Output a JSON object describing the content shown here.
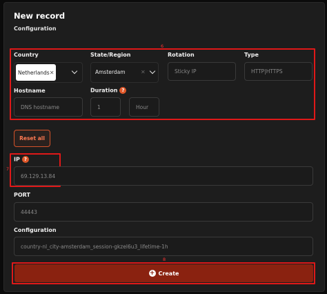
{
  "header": {
    "title": "New record",
    "subtitle": "Configuration"
  },
  "markers": {
    "config_box": "6",
    "ip_box": "7",
    "create_box": "8"
  },
  "country": {
    "label": "Country",
    "selected_chip": "Netherlands",
    "chip_remove": "✕"
  },
  "state": {
    "label": "State/Region",
    "value": "Amsterdam",
    "clear": "✕"
  },
  "rotation": {
    "label": "Rotation",
    "placeholder": "Sticky IP"
  },
  "type": {
    "label": "Type",
    "placeholder": "HTTP|HTTPS"
  },
  "hostname": {
    "label": "Hostname",
    "placeholder": "DNS hostname"
  },
  "duration": {
    "label": "Duration",
    "help": "?",
    "value": "1",
    "unit_placeholder": "Hour"
  },
  "reset": {
    "label": "Reset all"
  },
  "ip": {
    "label": "IP",
    "help": "?",
    "value": "69.129.13.84"
  },
  "port": {
    "label": "PORT",
    "value": "44443"
  },
  "configuration": {
    "label": "Configuration",
    "value": "country-nl_city-amsterdam_session-gkzel6u3_lifetime-1h"
  },
  "create": {
    "label": "Create",
    "icon": "+"
  },
  "colors": {
    "highlight": "#e01818",
    "accent": "#e0582a",
    "create_bg": "#8a2210"
  }
}
